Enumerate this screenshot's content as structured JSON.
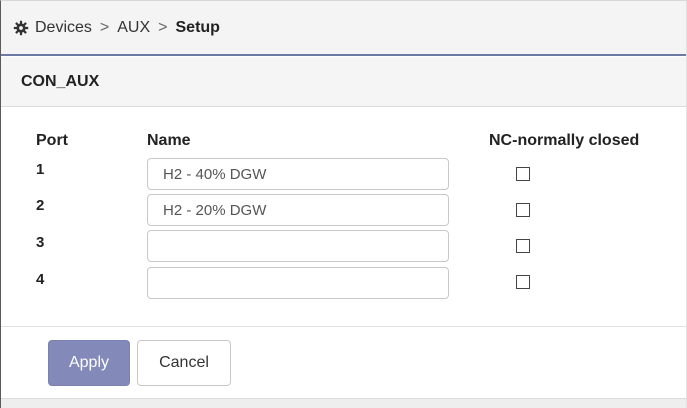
{
  "breadcrumb": {
    "items": [
      "Devices",
      "AUX"
    ],
    "separator": ">",
    "current": "Setup"
  },
  "section": {
    "title": "CON_AUX"
  },
  "table": {
    "headers": {
      "port": "Port",
      "name": "Name",
      "nc": "NC-normally closed"
    },
    "rows": [
      {
        "port": "1",
        "name": "H2 - 40% DGW",
        "nc_checked": false
      },
      {
        "port": "2",
        "name": "H2 - 20% DGW",
        "nc_checked": false
      },
      {
        "port": "3",
        "name": "",
        "nc_checked": false
      },
      {
        "port": "4",
        "name": "",
        "nc_checked": false
      }
    ]
  },
  "buttons": {
    "apply": "Apply",
    "cancel": "Cancel"
  },
  "colors": {
    "accent": "#6d7aa8",
    "apply_bg": "#8389b8"
  },
  "icons": {
    "breadcrumb": "gear-icon"
  }
}
